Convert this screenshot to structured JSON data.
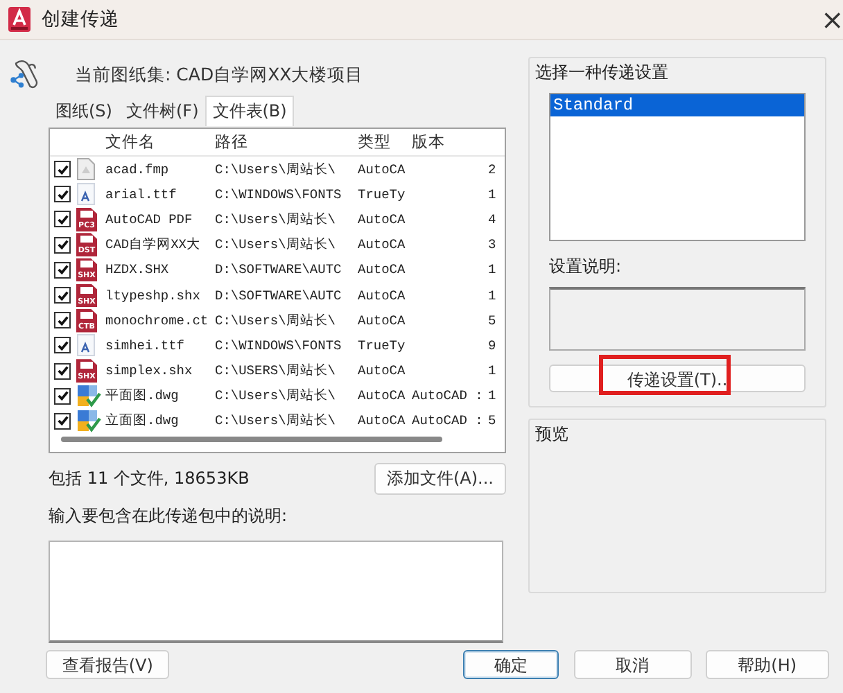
{
  "window": {
    "title": "创建传递",
    "close": "×"
  },
  "sheet_set": {
    "label": "当前图纸集: CAD自学网XX大楼项目"
  },
  "tabs": [
    {
      "label": "图纸(S)",
      "selected": false
    },
    {
      "label": "文件树(F)",
      "selected": false
    },
    {
      "label": "文件表(B)",
      "selected": true
    }
  ],
  "table": {
    "columns": [
      "文件名",
      "路径",
      "类型",
      "版本"
    ],
    "rows": [
      {
        "checked": true,
        "icon": {
          "kind": "doc"
        },
        "name": "acad.fmp",
        "path": "C:\\Users\\周站长\\",
        "type": "AutoCA",
        "column_5": "2"
      },
      {
        "checked": true,
        "icon": {
          "kind": "font"
        },
        "name": "arial.ttf",
        "path": "C:\\WINDOWS\\FONTS",
        "type": "TrueTy",
        "column_5": "1"
      },
      {
        "checked": true,
        "icon": {
          "kind": "badge",
          "badge": "PC3"
        },
        "name": "AutoCAD PDF",
        "path": "C:\\Users\\周站长\\",
        "type": "AutoCA",
        "column_5": "4"
      },
      {
        "checked": true,
        "icon": {
          "kind": "badge",
          "badge": "DST"
        },
        "name": "CAD自学网XX大",
        "path": "C:\\Users\\周站长\\",
        "type": "AutoCA",
        "column_5": "3"
      },
      {
        "checked": true,
        "icon": {
          "kind": "badge",
          "badge": "SHX"
        },
        "name": "HZDX.SHX",
        "path": "D:\\SOFTWARE\\AUTC",
        "type": "AutoCA",
        "column_5": "1"
      },
      {
        "checked": true,
        "icon": {
          "kind": "badge",
          "badge": "SHX"
        },
        "name": "ltypeshp.shx",
        "path": "D:\\SOFTWARE\\AUTC",
        "type": "AutoCA",
        "column_5": "1"
      },
      {
        "checked": true,
        "icon": {
          "kind": "badge",
          "badge": "CTB"
        },
        "name": "monochrome.ct",
        "path": "C:\\Users\\周站长\\",
        "type": "AutoCA",
        "column_5": "5"
      },
      {
        "checked": true,
        "icon": {
          "kind": "font"
        },
        "name": "simhei.ttf",
        "path": "C:\\WINDOWS\\FONTS",
        "type": "TrueTy",
        "column_5": "9"
      },
      {
        "checked": true,
        "icon": {
          "kind": "badge",
          "badge": "SHX"
        },
        "name": "simplex.shx",
        "path": "C:\\USERS\\周站长\\",
        "type": "AutoCA",
        "column_5": "1"
      },
      {
        "checked": true,
        "icon": {
          "kind": "dwg"
        },
        "name": "平面图.dwg",
        "path": "C:\\Users\\周站长\\",
        "type": "AutoCA",
        "version": "AutoCAD :",
        "column_5": "1"
      },
      {
        "checked": true,
        "icon": {
          "kind": "dwg"
        },
        "name": "立面图.dwg",
        "path": "C:\\Users\\周站长\\",
        "type": "AutoCA",
        "version": "AutoCAD :",
        "column_5": "5"
      }
    ]
  },
  "summary": "包括 11 个文件, 18653KB",
  "add_file_button": "添加文件(A)...",
  "notes": {
    "label": "输入要包含在此传递包中的说明:"
  },
  "setups": {
    "label": "选择一种传递设置",
    "items": [
      {
        "label": "Standard",
        "selected": true
      }
    ],
    "description_label": "设置说明:",
    "button": {
      "label": "传递设置(T)..",
      "highlighted": true
    }
  },
  "preview": {
    "label": "预览"
  },
  "buttons": [
    {
      "label": "查看报告(V)",
      "default": false
    },
    {
      "label": "确定",
      "default": true
    },
    {
      "label": "取消",
      "default": false
    },
    {
      "label": "帮助(H)",
      "default": false
    }
  ]
}
